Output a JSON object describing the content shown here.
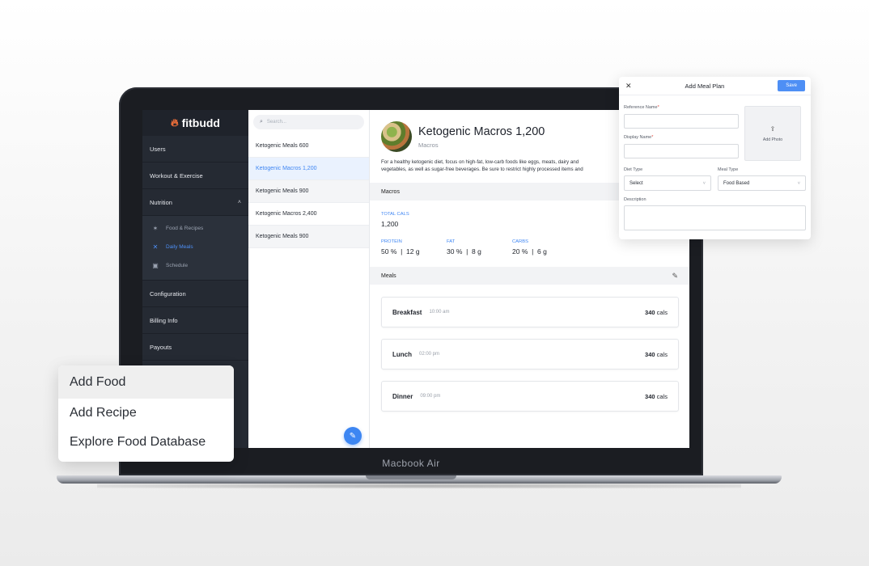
{
  "device_label": "Macbook Air",
  "brand": {
    "name": "fitbudd",
    "icon": "flame-icon"
  },
  "sidebar": {
    "items": [
      {
        "label": "Users"
      },
      {
        "label": "Workout & Exercise"
      },
      {
        "label": "Nutrition",
        "expanded": true
      },
      {
        "label": "Configuration"
      },
      {
        "label": "Billing Info"
      },
      {
        "label": "Payouts"
      }
    ],
    "nutrition_sub": [
      {
        "label": "Food & Recipes",
        "icon": "carrot-icon"
      },
      {
        "label": "Daily Meals",
        "icon": "cutlery-icon",
        "active": true
      },
      {
        "label": "Schedule",
        "icon": "calendar-icon"
      }
    ]
  },
  "search": {
    "placeholder": "Search..."
  },
  "meal_plans": [
    {
      "name": "Ketogenic Meals 600"
    },
    {
      "name": "Ketogenic Macros 1,200",
      "selected": true
    },
    {
      "name": "Ketogenic Meals 900"
    },
    {
      "name": "Ketogenic Macros 2,400"
    },
    {
      "name": "Ketogenic Meals 900"
    }
  ],
  "detail": {
    "title": "Ketogenic Macros 1,200",
    "subtitle": "Macros",
    "description_line1": "For a healthy ketogenic diet, focus on high-fat, low-carb foods like eggs, meats, dairy and",
    "description_line2": "vegetables, as well as sugar-free beverages. Be sure to restrict highly processed items and",
    "macros_header": "Macros",
    "total_cals_label": "TOTAL CALS",
    "total_cals_value": "1,200",
    "protein": {
      "label": "PROTEIN",
      "pct": "50 %",
      "grams": "12 g"
    },
    "fat": {
      "label": "FAT",
      "pct": "30 %",
      "grams": "8 g"
    },
    "carbs": {
      "label": "CARBS",
      "pct": "20 %",
      "grams": "6 g"
    },
    "meals_header": "Meals",
    "meals": [
      {
        "name": "Breakfast",
        "time": "10:00 am",
        "cals": "340",
        "unit": "cals"
      },
      {
        "name": "Lunch",
        "time": "02:00 pm",
        "cals": "340",
        "unit": "cals"
      },
      {
        "name": "Dinner",
        "time": "09:00 pm",
        "cals": "340",
        "unit": "cals"
      }
    ]
  },
  "add_meal_plan": {
    "title": "Add Meal Plan",
    "save": "Save",
    "reference_name_label": "Reference Name",
    "display_name_label": "Display Name",
    "required_mark": "*",
    "add_photo": "Add Photo",
    "diet_type_label": "Diet Type",
    "diet_type_value": "Select",
    "meal_type_label": "Meal Type",
    "meal_type_value": "Food Based",
    "description_label": "Description"
  },
  "popup_menu": {
    "items": [
      "Add Food",
      "Add Recipe",
      "Explore Food Database"
    ]
  },
  "colors": {
    "accent": "#3d86f2",
    "sidebar": "#252a33",
    "brand_flame": "#f2703a"
  }
}
